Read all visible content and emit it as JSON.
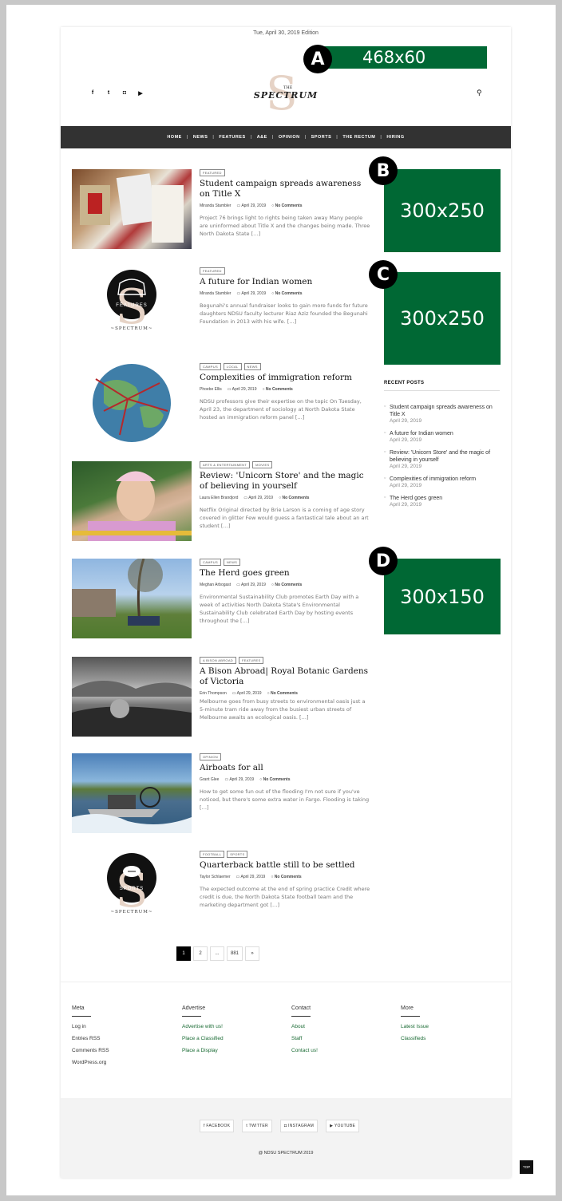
{
  "edition": "Tue, April 30, 2019 Edition",
  "ads": {
    "a": {
      "badge": "A",
      "label": "468x60"
    },
    "b": {
      "badge": "B",
      "label": "300x250"
    },
    "c": {
      "badge": "C",
      "label": "300x250"
    },
    "d": {
      "badge": "D",
      "label": "300x150"
    },
    "color": "#006834"
  },
  "header": {
    "social_icons": [
      "facebook-icon",
      "twitter-icon",
      "instagram-icon",
      "youtube-icon"
    ],
    "social_glyphs": [
      "f",
      "t",
      "◘",
      "▶"
    ],
    "logo_the": "THE",
    "logo_word": "SPECTRUM",
    "logo_s": "S",
    "search_glyph": "⚲"
  },
  "nav": [
    "HOME",
    "NEWS",
    "FEATURES",
    "A&E",
    "OPINION",
    "SPORTS",
    "THE RECTUM",
    "HIRING"
  ],
  "posts": [
    {
      "cats": [
        "FEATURED"
      ],
      "title": "Student campaign spreads awareness on Title X",
      "author": "Miranda Stambler",
      "date": "April 29, 2019",
      "comments": "No Comments",
      "excerpt": "Project 76 brings light to rights being taken away Many people are uninformed about Title X and the changes being made. Three North Dakota State […]"
    },
    {
      "cats": [
        "FEATURED"
      ],
      "title": "A future for Indian women",
      "author": "Miranda Stambler",
      "date": "April 29, 2019",
      "comments": "No Comments",
      "excerpt": "Begunahi's annual fundraiser looks to gain more funds for future daughters NDSU faculty lecturer Riaz Aziz founded the Begunahi Foundation in 2013 with his wife. […]"
    },
    {
      "cats": [
        "CAMPUS",
        "LOCAL",
        "NEWS"
      ],
      "title": "Complexities of immigration reform",
      "author": "Phoebe Ellis",
      "date": "April 29, 2019",
      "comments": "No Comments",
      "excerpt": "NDSU professors give their expertise on the topic On Tuesday, April 23, the department of sociology at North Dakota State hosted an immigration reform panel […]"
    },
    {
      "cats": [
        "ARTS & ENTERTAINMENT",
        "MOVIES"
      ],
      "title": "Review: 'Unicorn Store' and the magic of believing in yourself",
      "author": "Laura Ellen Brandjord",
      "date": "April 29, 2019",
      "comments": "No Comments",
      "excerpt": "Netflix Original directed by Brie Larson is a coming of age story covered in glitter Few would guess a fantastical tale about an art student […]"
    },
    {
      "cats": [
        "CAMPUS",
        "NEWS"
      ],
      "title": "The Herd goes green",
      "author": "Meghan Arbogast",
      "date": "April 29, 2019",
      "comments": "No Comments",
      "excerpt": "Environmental Sustainability Club promotes Earth Day with a week of activities North Dakota State's Environmental Sustainability Club celebrated Earth Day by hosting events throughout the […]"
    },
    {
      "cats": [
        "A BISON ABROAD",
        "FEATURES"
      ],
      "title": "A Bison Abroad| Royal Botanic Gardens of Victoria",
      "author": "Erin Thompson",
      "date": "April 29, 2019",
      "comments": "No Comments",
      "excerpt": "Melbourne goes from busy streets to environmental oasis just a 5-minute tram ride away from the busiest urban streets of Melbourne awaits an ecological oasis. […]"
    },
    {
      "cats": [
        "OPINION"
      ],
      "title": "Airboats for all",
      "author": "Grant Glee",
      "date": "April 29, 2019",
      "comments": "No Comments",
      "excerpt": "How to get some fun out of the flooding I'm not sure if you've noticed, but there's some extra water in Fargo. Flooding is taking […]"
    },
    {
      "cats": [
        "FOOTBALL",
        "SPORTS"
      ],
      "title": "Quarterback battle still to be settled",
      "author": "Taylor Schlaemer",
      "date": "April 29, 2019",
      "comments": "No Comments",
      "excerpt": "The expected outcome at the end of spring practice Credit where credit is due, the North Dakota State football team and the marketing department got […]"
    }
  ],
  "badges": {
    "features": "FEATURES",
    "sports": "SPORTS",
    "spectrum": "~SPECTRUM~"
  },
  "sidebar": {
    "title": "RECENT POSTS",
    "items": [
      {
        "title": "Student campaign spreads awareness on Title X",
        "date": "April 29, 2019"
      },
      {
        "title": "A future for Indian women",
        "date": "April 29, 2019"
      },
      {
        "title": "Review: 'Unicorn Store' and the magic of believing in yourself",
        "date": "April 29, 2019"
      },
      {
        "title": "Complexities of immigration reform",
        "date": "April 29, 2019"
      },
      {
        "title": "The Herd goes green",
        "date": "April 29, 2019"
      }
    ]
  },
  "pagination": [
    "1",
    "2",
    "...",
    "881",
    "»"
  ],
  "footer": {
    "meta": {
      "heading": "Meta",
      "items": [
        "Log in",
        "Entries RSS",
        "Comments RSS",
        "WordPress.org"
      ]
    },
    "advertise": {
      "heading": "Advertise",
      "items": [
        "Advertise with us!",
        "Place a Classified",
        "Place a Display"
      ]
    },
    "contact": {
      "heading": "Contact",
      "items": [
        "About",
        "Staff",
        "Contact us!"
      ]
    },
    "more": {
      "heading": "More",
      "items": [
        "Latest Issue",
        "Classifieds"
      ]
    },
    "social": [
      "FACEBOOK",
      "TWITTER",
      "INSTAGRAM",
      "YOUTUBE"
    ],
    "social_glyphs": [
      "f",
      "t",
      "◘",
      "▶"
    ],
    "copyright": "@ NDSU SPECTRUM 2019"
  },
  "top_button": "TOP"
}
